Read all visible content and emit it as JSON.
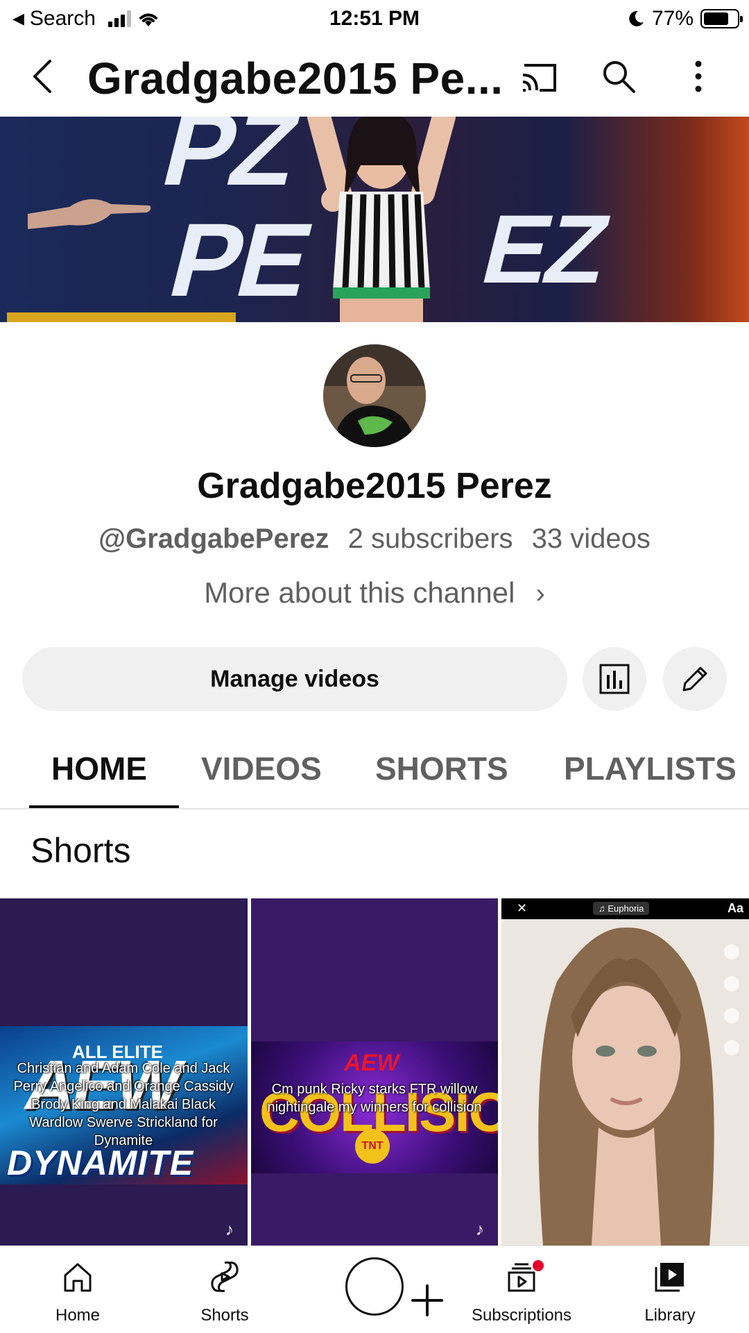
{
  "status_bar": {
    "back_app": "Search",
    "time": "12:51 PM",
    "battery": "77%",
    "battery_level": 0.77
  },
  "app_bar": {
    "title": "Gradgabe2015 Pe...",
    "icons": [
      "back-icon",
      "cast-icon",
      "search-icon",
      "more-icon"
    ]
  },
  "channel": {
    "name": "Gradgabe2015 Perez",
    "handle": "@GradgabePerez",
    "subscribers": "2 subscribers",
    "videos": "33 videos",
    "more_about": "More about this channel"
  },
  "actions": {
    "manage_videos": "Manage videos"
  },
  "tabs": [
    "HOME",
    "VIDEOS",
    "SHORTS",
    "PLAYLISTS"
  ],
  "section_title": "Shorts",
  "shorts": [
    {
      "logo_top": "ALL ELITE",
      "logo_main": "AEW",
      "logo_bottom": "DYNAMITE",
      "caption": "Christian and Adam Cole and Jack Perry Angelico and Orange Cassidy Brody King and Malakai Black Wardlow Swerve Strickland for Dynamite"
    },
    {
      "logo_top": "AEW",
      "logo_main": "COLLISION",
      "logo_badge": "TNT",
      "caption": "Cm punk Ricky starks FTR willow nightingale my winners for collision"
    },
    {
      "music": "Euphoria",
      "text_tool": "Aa"
    }
  ],
  "bottom_nav": {
    "home": "Home",
    "shorts": "Shorts",
    "subscriptions": "Subscriptions",
    "library": "Library"
  },
  "colors": {
    "accent": "#0f0f0f",
    "secondary_text": "#606060",
    "chip_bg": "#f0f0f0",
    "notification": "#e4002b"
  }
}
